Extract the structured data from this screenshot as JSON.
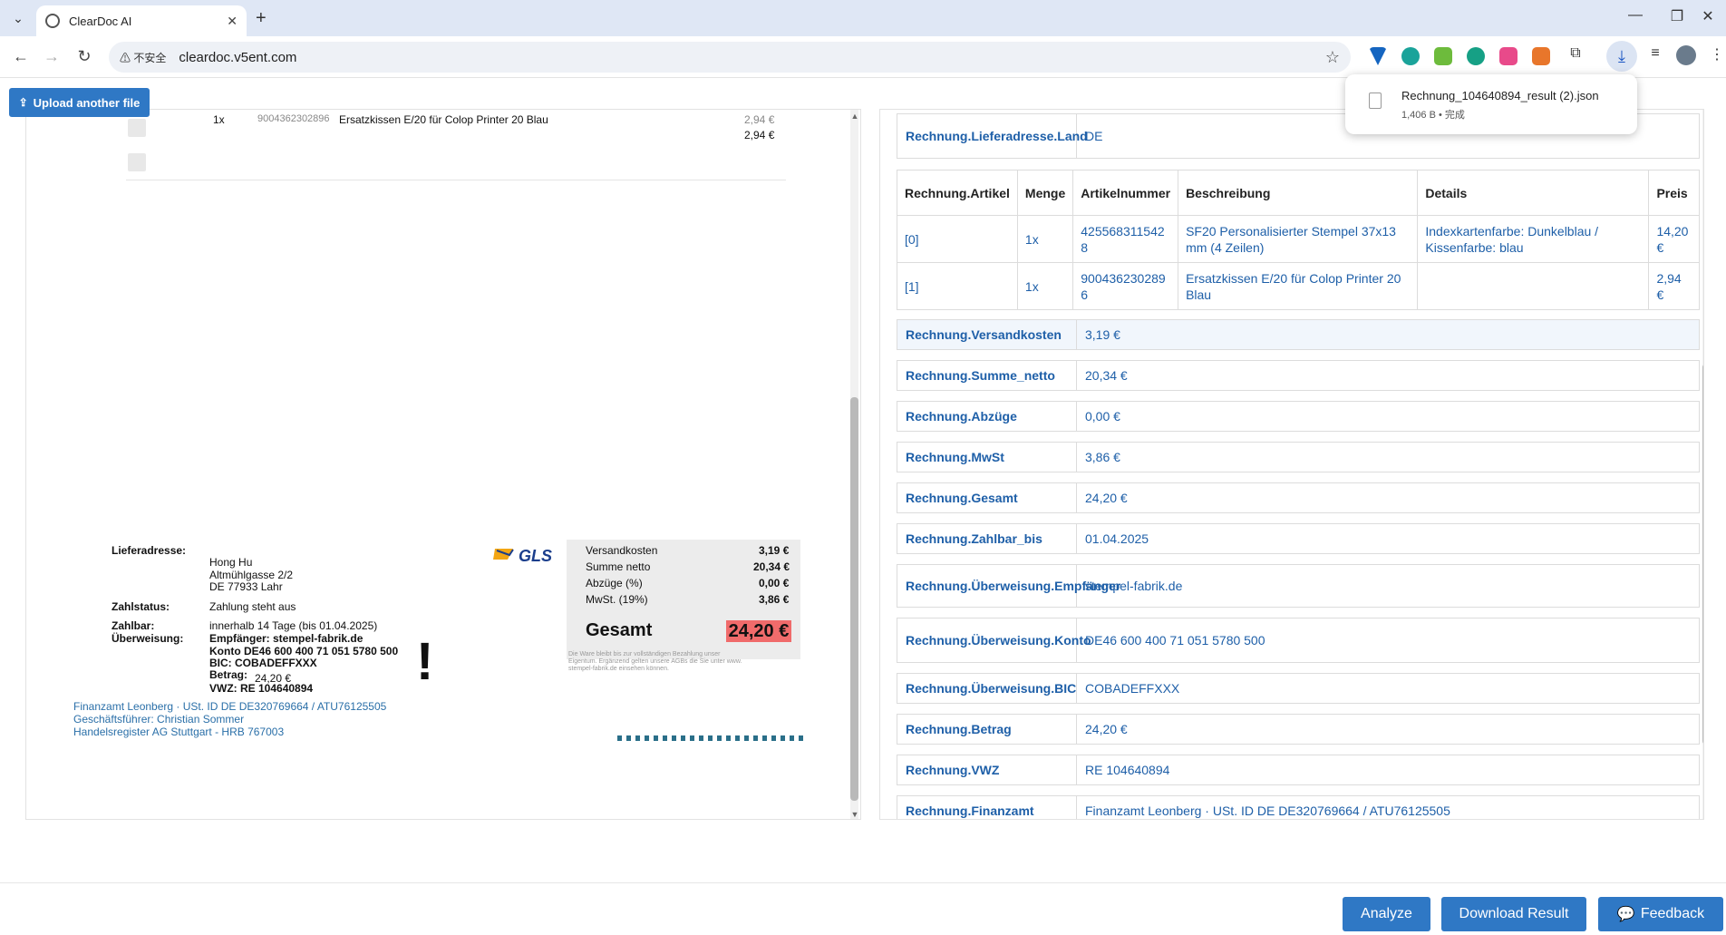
{
  "browser": {
    "tab_title": "ClearDoc AI",
    "security_label": "不安全",
    "url": "cleardoc.v5ent.com",
    "download": {
      "file_name": "Rechnung_104640894_result (2).json",
      "meta": "1,406 B • 完成"
    }
  },
  "app": {
    "upload_button": "Upload another file",
    "bottom": {
      "analyze": "Analyze",
      "download": "Download Result",
      "feedback": "Feedback"
    }
  },
  "document": {
    "item_row": {
      "qty": "1x",
      "sku": "9004362302896",
      "name": "Ersatzkissen E/20 für Colop Printer 20 Blau",
      "price": "2,94 €",
      "price_total": "2,94 €"
    },
    "delivery": {
      "label": "Lieferadresse:",
      "name": "Hong Hu",
      "street": "Altmühlgasse 2/2",
      "city": "DE 77933 Lahr"
    },
    "payment_status": {
      "label": "Zahlstatus:",
      "value": "Zahlung steht aus"
    },
    "payable": {
      "label": "Zahlbar:",
      "value": "innerhalb 14 Tage  (bis 01.04.2025)"
    },
    "transfer": {
      "label": "Überweisung:",
      "recipient": "Empfänger: stempel-fabrik.de",
      "account": "Konto DE46 600 400 71 051 5780 500",
      "bic": "BIC: COBADEFFXXX",
      "amount_label": "Betrag:",
      "amount": "24,20 €",
      "vwz": "VWZ: RE 104640894"
    },
    "exclamation": "!",
    "footer": [
      "Finanzamt Leonberg · USt. ID DE DE320769664 / ATU76125505",
      "Geschäftsführer: Christian Sommer",
      "Handelsregister AG Stuttgart - HRB 767003"
    ],
    "carrier_logo": "GLS",
    "totals": [
      {
        "label": "Versandkosten",
        "value": "3,19 €"
      },
      {
        "label": "Summe netto",
        "value": "20,34 €"
      },
      {
        "label": "Abzüge (%)",
        "value": "0,00 €"
      },
      {
        "label": "MwSt. (19%)",
        "value": "3,86 €"
      }
    ],
    "gesamt_label": "Gesamt",
    "gesamt_value": "24,20 €",
    "fine_print": [
      "Die Ware bleibt bis zur vollständigen Bezahlung unser",
      "Eigentum. Ergänzend gelten unsere AGBs die Sie unter www.",
      "stempel-fabrik.de einsehen können."
    ]
  },
  "results": {
    "land": {
      "key": "Rechnung.Lieferadresse.Land",
      "value": "DE"
    },
    "items_headers": [
      "Rechnung.Artikel",
      "Menge",
      "Artikelnummer",
      "Beschreibung",
      "Details",
      "Preis"
    ],
    "items": [
      {
        "idx": "[0]",
        "qty": "1x",
        "sku": "4255683115428",
        "desc": "SF20 Personalisierter Stempel 37x13 mm (4 Zeilen)",
        "details": "Indexkartenfarbe: Dunkelblau / Kissenfarbe: blau",
        "price": "14,20 €"
      },
      {
        "idx": "[1]",
        "qty": "1x",
        "sku": "9004362302896",
        "desc": "Ersatzkissen E/20 für Colop Printer 20 Blau",
        "details": "",
        "price": "2,94 €"
      }
    ],
    "fields": [
      {
        "key": "Rechnung.Versandkosten",
        "value": "3,19 €"
      },
      {
        "key": "Rechnung.Summe_netto",
        "value": "20,34 €"
      },
      {
        "key": "Rechnung.Abzüge",
        "value": "0,00 €"
      },
      {
        "key": "Rechnung.MwSt",
        "value": "3,86 €"
      },
      {
        "key": "Rechnung.Gesamt",
        "value": "24,20 €"
      },
      {
        "key": "Rechnung.Zahlbar_bis",
        "value": "01.04.2025"
      },
      {
        "key": "Rechnung.Überweisung.Empfänger",
        "value": "stempel-fabrik.de"
      },
      {
        "key": "Rechnung.Überweisung.Konto",
        "value": "DE46 600 400 71 051 5780 500"
      },
      {
        "key": "Rechnung.Überweisung.BIC",
        "value": "COBADEFFXXX"
      },
      {
        "key": "Rechnung.Betrag",
        "value": "24,20 €"
      },
      {
        "key": "Rechnung.VWZ",
        "value": "RE 104640894"
      },
      {
        "key": "Rechnung.Finanzamt",
        "value": "Finanzamt Leonberg · USt. ID DE DE320769664 / ATU76125505"
      }
    ]
  }
}
